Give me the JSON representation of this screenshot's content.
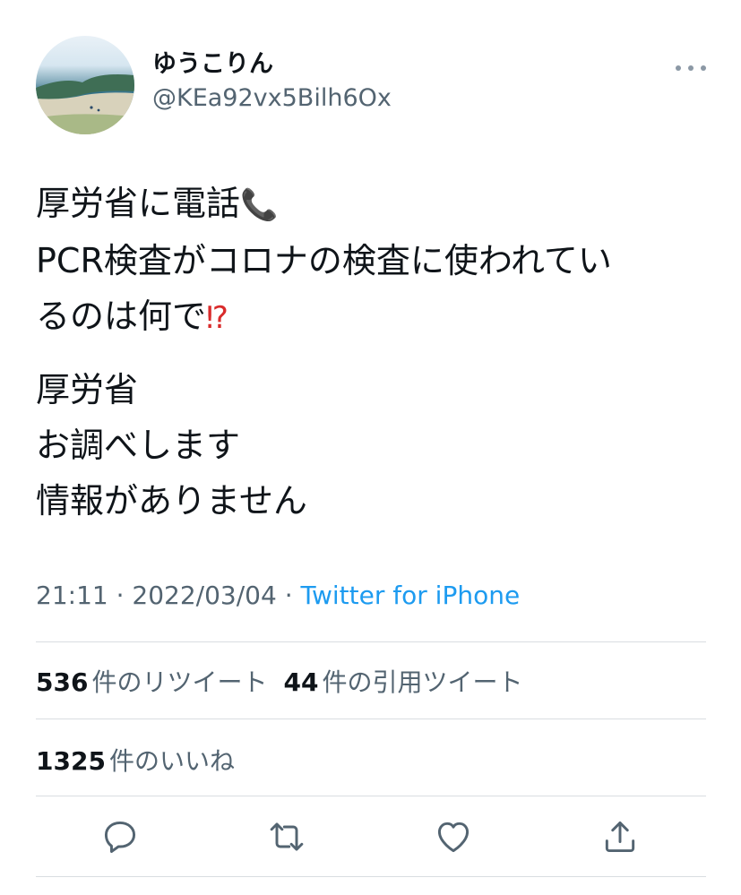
{
  "user": {
    "display_name": "ゆうこりん",
    "handle": "@KEa92vx5Bilh6Ox"
  },
  "tweet": {
    "lines": [
      "厚労省に電話",
      "PCR検査がコロナの検査に使われてい",
      "るのは何で",
      "厚労省",
      "お調べします",
      "情報がありません"
    ],
    "emoji_phone": "📞",
    "emoji_exclaim": "⁉"
  },
  "meta": {
    "time": "21:11",
    "date": "2022/03/04",
    "separator": "·",
    "source": "Twitter for iPhone"
  },
  "stats": {
    "retweets_count": "536",
    "retweets_label": "件のリツイート",
    "quotes_count": "44",
    "quotes_label": "件の引用ツイート",
    "likes_count": "1325",
    "likes_label": "件のいいね"
  },
  "icons": {
    "more": "more-icon",
    "reply": "reply-icon",
    "retweet": "retweet-icon",
    "like": "heart-icon",
    "share": "share-icon"
  },
  "colors": {
    "link": "#1d9bf0",
    "secondary_text": "#536471",
    "icon": "#536471"
  }
}
